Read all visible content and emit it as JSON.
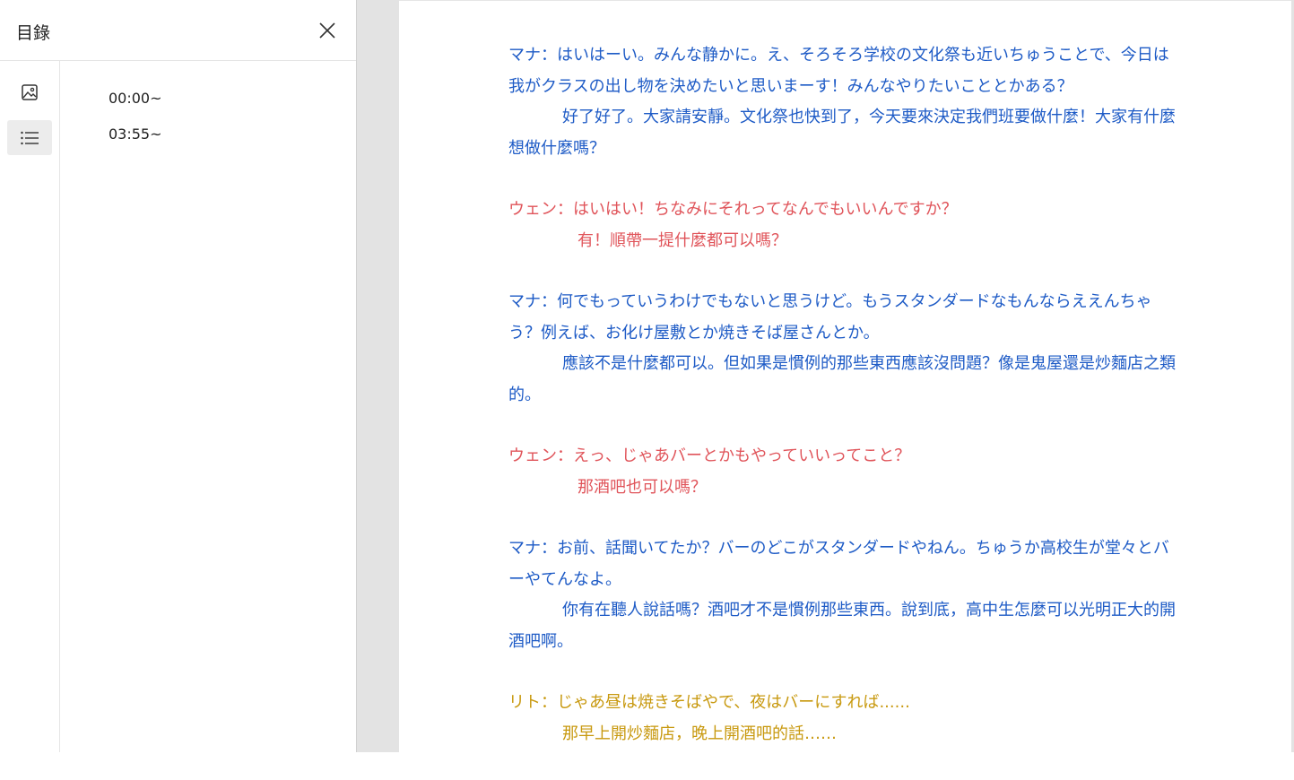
{
  "toc": {
    "title": "目錄",
    "items": [
      {
        "label": "00:00~"
      },
      {
        "label": "03:55~"
      }
    ]
  },
  "icons": {
    "close": "close-icon",
    "image": "image-icon",
    "list": "list-icon"
  },
  "colors": {
    "mana": "#1e5bc6",
    "wen": "#e0545a",
    "rito": "#c8990f"
  },
  "dialogue": [
    {
      "speaker": "mana",
      "jp": "マナ：はいはーい。みんな静かに。え、そろそろ学校の文化祭も近いちゅうことで、今日は我がクラスの出し物を決めたいと思いまーす！みんなやりたいこととかある？",
      "zh": "好了好了。大家請安靜。文化祭也快到了，今天要來決定我們班要做什麼！大家有什麼想做什麼嗎？"
    },
    {
      "speaker": "wen",
      "jp": "ウェン：はいはい！ちなみにそれってなんでもいいんですか？",
      "zh": "有！順帶一提什麼都可以嗎？"
    },
    {
      "speaker": "mana",
      "jp": "マナ：何でもっていうわけでもないと思うけど。もうスタンダードなもんならええんちゃう？例えば、お化け屋敷とか焼きそば屋さんとか。",
      "zh": "應該不是什麼都可以。但如果是慣例的那些東西應該沒問題？像是鬼屋還是炒麵店之類的。"
    },
    {
      "speaker": "wen",
      "jp": "ウェン：えっ、じゃあバーとかもやっていいってこと？",
      "zh": "那酒吧也可以嗎？"
    },
    {
      "speaker": "mana",
      "jp": "マナ：お前、話聞いてたか？バーのどこがスタンダードやねん。ちゅうか高校生が堂々とバーやてんなよ。",
      "zh": "你有在聽人說話嗎？酒吧才不是慣例那些東西。說到底，高中生怎麼可以光明正大的開酒吧啊。"
    },
    {
      "speaker": "rito",
      "jp": "リト：じゃあ昼は焼きそばやで、夜はバーにすれば......",
      "zh": "那早上開炒麵店，晚上開酒吧的話……"
    }
  ]
}
